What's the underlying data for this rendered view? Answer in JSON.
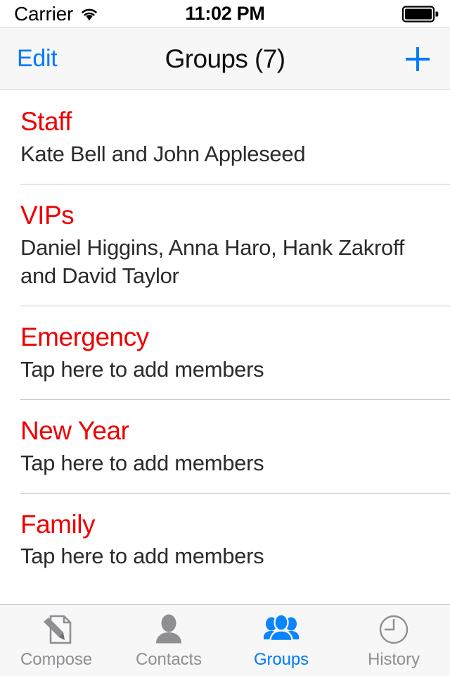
{
  "status_bar": {
    "carrier": "Carrier",
    "wifi_icon": "wifi-icon",
    "time": "11:02 PM",
    "battery_icon": "battery-full-icon"
  },
  "nav_bar": {
    "edit_label": "Edit",
    "title": "Groups (7)",
    "add_icon": "plus-icon"
  },
  "colors": {
    "accent_blue": "#007AFF",
    "group_red": "#EE0000",
    "bar_background": "#F7F7F7",
    "separator": "#C8C7CC",
    "inactive_tab": "#8E8E93"
  },
  "groups": [
    {
      "name": "Staff",
      "members": "Kate Bell and John Appleseed"
    },
    {
      "name": "VIPs",
      "members": "Daniel Higgins, Anna Haro, Hank Zakroff and David Taylor"
    },
    {
      "name": "Emergency",
      "members": "Tap here to add members"
    },
    {
      "name": "New Year",
      "members": "Tap here to add members"
    },
    {
      "name": "Family",
      "members": "Tap here to add members"
    }
  ],
  "tab_bar": {
    "items": [
      {
        "label": "Compose",
        "icon": "compose-icon",
        "active": false
      },
      {
        "label": "Contacts",
        "icon": "contacts-icon",
        "active": false
      },
      {
        "label": "Groups",
        "icon": "groups-icon",
        "active": true
      },
      {
        "label": "History",
        "icon": "history-icon",
        "active": false
      }
    ]
  }
}
